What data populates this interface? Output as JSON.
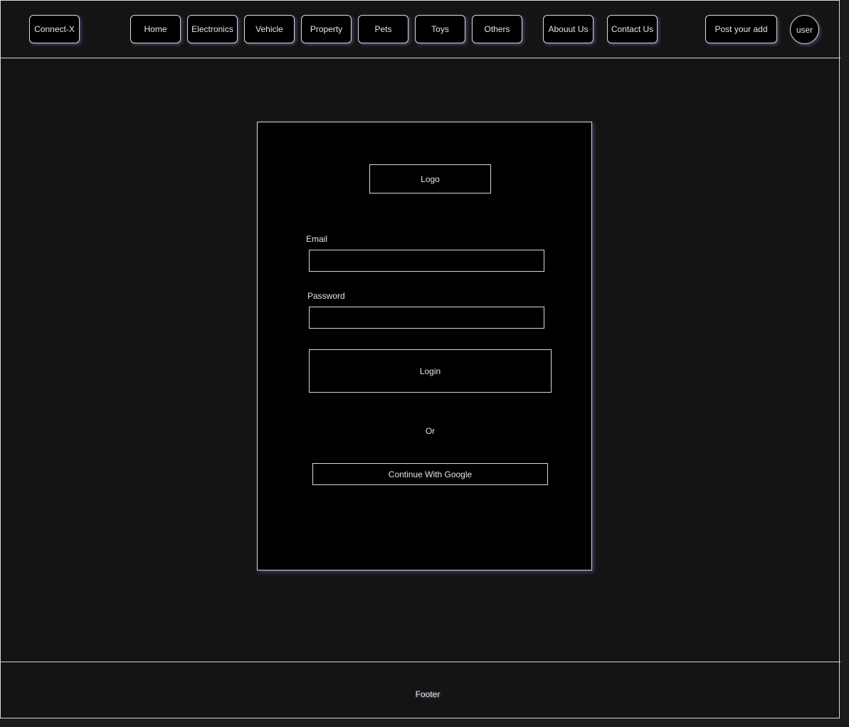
{
  "header": {
    "brand": "Connect-X",
    "nav": {
      "home": "Home",
      "electronics": "Electronics",
      "vehicle": "Vehicle",
      "property": "Property",
      "pets": "Pets",
      "toys": "Toys",
      "others": "Others",
      "about": "Abouut Us",
      "contact": "Contact Us"
    },
    "post_ad": "Post your add",
    "user": "user"
  },
  "login_card": {
    "logo": "Logo",
    "email_label": "Email",
    "email_value": "",
    "password_label": "Password",
    "password_value": "",
    "login_button": "Login",
    "or_text": "Or",
    "google_button": "Continue With Google"
  },
  "footer": {
    "text": "Footer"
  },
  "colors": {
    "page_background": "#141414",
    "card_background": "#000000",
    "border": "#d8d8d8",
    "text": "#e6e6e6",
    "glow": "#a0a0ff"
  }
}
